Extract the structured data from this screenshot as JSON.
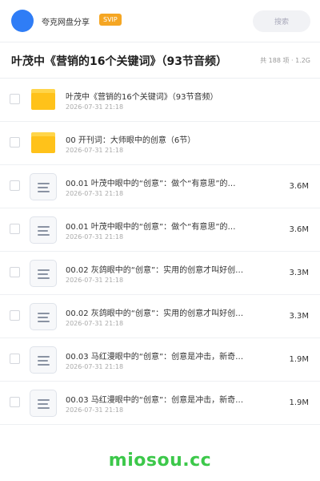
{
  "header": {
    "app_title": "夸克网盘分享",
    "badge": "SVIP",
    "search_placeholder": "搜索"
  },
  "page": {
    "title": "叶茂中《营销的16个关键词》（93节音频）",
    "meta": "共 188 项 · 1.2G"
  },
  "files": [
    {
      "type": "folder",
      "name": "叶茂中《营销的16个关键词》（93节音频）",
      "date": "2026-07-31 21:18",
      "size": ""
    },
    {
      "type": "folder",
      "name": "00 开刊词：大师眼中的创意（6节）",
      "date": "2026-07-31 21:18",
      "size": ""
    },
    {
      "type": "file",
      "name": "00.01 叶茂中眼中的“创意”：做个“有意思”的…",
      "date": "2026-07-31 21:18",
      "size": "3.6M"
    },
    {
      "type": "file",
      "name": "00.01 叶茂中眼中的“创意”：做个“有意思”的…",
      "date": "2026-07-31 21:18",
      "size": "3.6M"
    },
    {
      "type": "file",
      "name": "00.02 灰鸽眼中的“创意”：实用的创意才叫好创…",
      "date": "2026-07-31 21:18",
      "size": "3.3M"
    },
    {
      "type": "file",
      "name": "00.02 灰鸽眼中的“创意”：实用的创意才叫好创…",
      "date": "2026-07-31 21:18",
      "size": "3.3M"
    },
    {
      "type": "file",
      "name": "00.03 马红漫眼中的“创意”：创意是冲击，新奇…",
      "date": "2026-07-31 21:18",
      "size": "1.9M"
    },
    {
      "type": "file",
      "name": "00.03 马红漫眼中的“创意”：创意是冲击，新奇…",
      "date": "2026-07-31 21:18",
      "size": "1.9M"
    }
  ],
  "footer": {
    "brand": "miosou.cc"
  },
  "colors": {
    "accent": "#2f7df6",
    "svip": "#f5a623",
    "folder": "#ffc21a",
    "brand_green": "#3cc84a"
  },
  "icons": {
    "folder": "folder-icon",
    "file": "document-icon"
  }
}
